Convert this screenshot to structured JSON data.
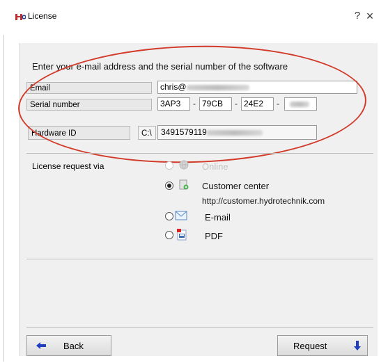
{
  "window": {
    "title": "License",
    "help": "?",
    "close": "×"
  },
  "instruction": "Enter your e-mail address and the serial number of the software",
  "email": {
    "label": "Email",
    "value_prefix": "chris@"
  },
  "serial": {
    "label": "Serial number",
    "parts": [
      "3AP3",
      "79CB",
      "24E2"
    ],
    "separator": "-"
  },
  "hardware": {
    "label": "Hardware ID",
    "drive": "C:\\",
    "value_prefix": "3491579119"
  },
  "license_request": {
    "label": "License request via",
    "options": [
      {
        "label": "Online",
        "state": "disabled",
        "icon": "globe-icon"
      },
      {
        "label": "Customer center",
        "state": "checked",
        "icon": "customer-center-icon"
      },
      {
        "label": "E-mail",
        "state": "unchecked",
        "icon": "envelope-icon"
      },
      {
        "label": "PDF",
        "state": "unchecked",
        "icon": "pdf-icon"
      }
    ],
    "customer_center_url": "http://customer.hydrotechnik.com"
  },
  "buttons": {
    "back": "Back",
    "request": "Request"
  },
  "colors": {
    "annotation": "#d23a2a",
    "arrow": "#1f3fbf",
    "panel": "#f0f0f0"
  }
}
